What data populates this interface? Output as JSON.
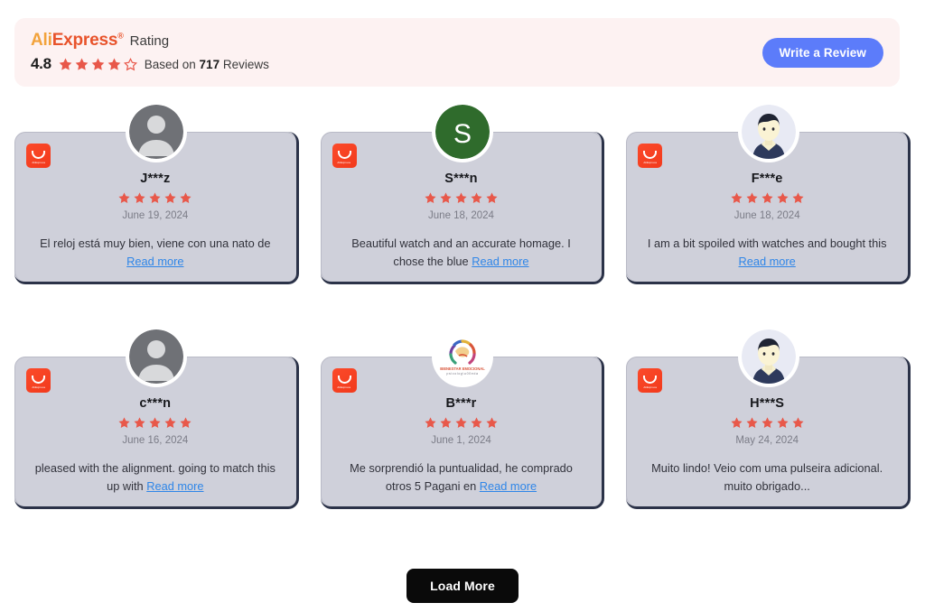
{
  "header": {
    "brand_ali": "Ali",
    "brand_express": "Express",
    "brand_tm": "®",
    "rating_word": "Rating",
    "score": "4.8",
    "based_prefix": "Based on",
    "review_count": "717",
    "based_suffix": "Reviews",
    "stars_filled": 4,
    "stars_total": 5,
    "write_review_label": "Write a Review",
    "accent_button_color": "#5c7cfa",
    "star_color": "#e8584a",
    "band_color": "#fdf2f2"
  },
  "badge": {
    "brand_text": "AliExpress"
  },
  "reviews": [
    {
      "name": "J***z",
      "stars": 5,
      "date": "June 19, 2024",
      "text": "El reloj está muy bien, viene con una nato de ",
      "read_more": "Read more",
      "avatar": "default-silhouette"
    },
    {
      "name": "S***n",
      "stars": 5,
      "date": "June 18, 2024",
      "text": "Beautiful watch and an accurate homage. I chose the blue ",
      "read_more": "Read more",
      "avatar": "initial-letter",
      "avatar_letter": "S",
      "avatar_color": "#2f6b2c"
    },
    {
      "name": "F***e",
      "stars": 5,
      "date": "June 18, 2024",
      "text": "I am a bit spoiled with watches and bought this ",
      "read_more": "Read more",
      "avatar": "male-face"
    },
    {
      "name": "c***n",
      "stars": 5,
      "date": "June 16, 2024",
      "text": "pleased with the alignment. going to match this up with ",
      "read_more": "Read more",
      "avatar": "default-silhouette"
    },
    {
      "name": "B***r",
      "stars": 5,
      "date": "June 1, 2024",
      "text": "Me sorprendió la puntualidad, he comprado otros 5 Pagani en ",
      "read_more": "Read more",
      "avatar": "logo-brain",
      "avatar_logo_line1": "BIENESTAR EMOCIONAL",
      "avatar_logo_line2": "psicología"
    },
    {
      "name": "H***S",
      "stars": 5,
      "date": "May 24, 2024",
      "text": "Muito lindo! Veio com uma pulseira adicional. muito obrigado...",
      "read_more": "",
      "avatar": "male-face"
    }
  ],
  "footer": {
    "load_more_label": "Load More"
  }
}
